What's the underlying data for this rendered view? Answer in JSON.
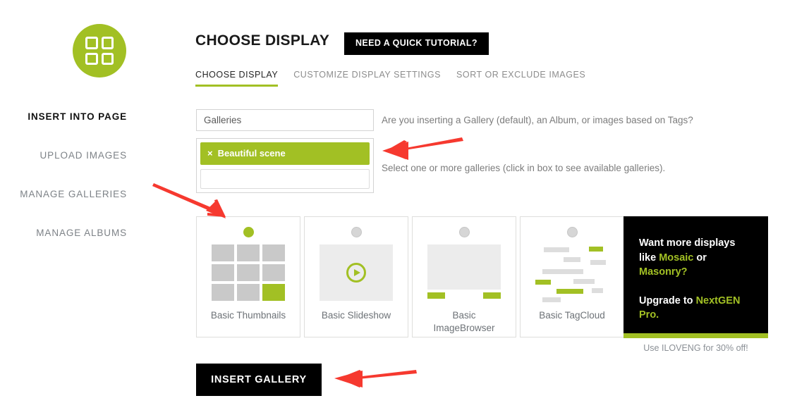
{
  "header": {
    "title": "CHOOSE DISPLAY",
    "tutorial_button": "NEED A QUICK TUTORIAL?",
    "logo_icon": "four-squares-grid-icon"
  },
  "tabs": [
    {
      "label": "CHOOSE DISPLAY",
      "active": true
    },
    {
      "label": "CUSTOMIZE DISPLAY SETTINGS",
      "active": false
    },
    {
      "label": "SORT OR EXCLUDE IMAGES",
      "active": false
    }
  ],
  "sidebar": {
    "items": [
      {
        "label": "INSERT INTO PAGE",
        "active": true
      },
      {
        "label": "UPLOAD IMAGES",
        "active": false
      },
      {
        "label": "MANAGE GALLERIES",
        "active": false
      },
      {
        "label": "MANAGE ALBUMS",
        "active": false
      }
    ]
  },
  "form": {
    "source_select": {
      "value": "Galleries"
    },
    "gallery_tags": [
      {
        "label": "Beautiful scene",
        "remove_icon": "×"
      }
    ],
    "tag_input_placeholder": "",
    "tag_input_value": "",
    "help_source": "Are you inserting a Gallery (default), an Album, or images based on Tags?",
    "help_galleries": "Select one or more galleries (click in box to see available galleries)."
  },
  "displays": [
    {
      "label": "Basic Thumbnails",
      "selected": true,
      "thumb": "grid-thumbnail-preview"
    },
    {
      "label": "Basic Slideshow",
      "selected": false,
      "thumb": "slideshow-play-preview"
    },
    {
      "label": "Basic\nImageBrowser",
      "selected": false,
      "thumb": "imagebrowser-preview"
    },
    {
      "label": "Basic TagCloud",
      "selected": false,
      "thumb": "tagcloud-preview"
    }
  ],
  "promo": {
    "line1_a": "Want more displays like ",
    "line1_b": "Mosaic",
    "line1_c": " or ",
    "line1_d": "Masonry?",
    "line2_a": "Upgrade to ",
    "line2_b": "NextGEN Pro.",
    "coupon_note": "Use ILOVENG for 30% off!"
  },
  "actions": {
    "insert_gallery": "INSERT GALLERY"
  },
  "colors": {
    "accent_green": "#a2c024",
    "black": "#000000",
    "arrow_red": "#f6392f",
    "thumb_gray": "#c9c9c9"
  }
}
